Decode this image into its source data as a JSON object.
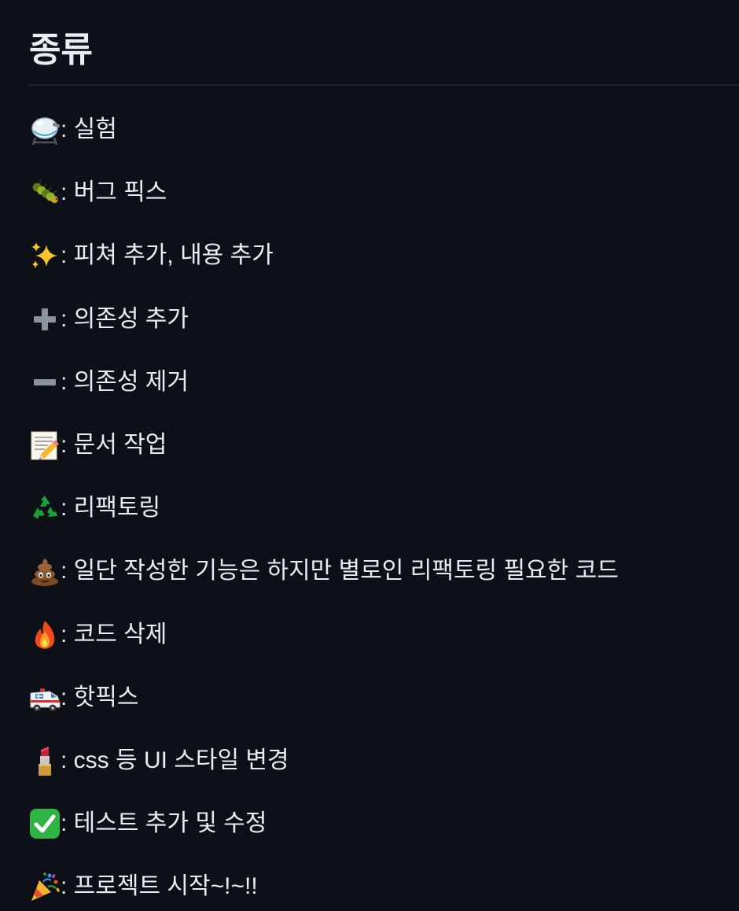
{
  "heading": "종류",
  "items": [
    {
      "icon": "alembic-icon",
      "label": ": 실험"
    },
    {
      "icon": "bug-icon",
      "label": ": 버그 픽스"
    },
    {
      "icon": "sparkles-icon",
      "label": ": 피쳐 추가, 내용 추가"
    },
    {
      "icon": "heavy-plus-icon",
      "label": " : 의존성 추가"
    },
    {
      "icon": "heavy-minus-icon",
      "label": " : 의존성 제거"
    },
    {
      "icon": "memo-icon",
      "label": ": 문서 작업"
    },
    {
      "icon": "recycle-icon",
      "label": ": 리팩토링"
    },
    {
      "icon": "poop-icon",
      "label": ": 일단 작성한 기능은 하지만 별로인 리팩토링 필요한 코드"
    },
    {
      "icon": "fire-icon",
      "label": ": 코드 삭제"
    },
    {
      "icon": "ambulance-icon",
      "label": ": 핫픽스"
    },
    {
      "icon": "lipstick-icon",
      "label": ": css 등 UI 스타일 변경"
    },
    {
      "icon": "check-mark-button-icon",
      "label": ": 테스트 추가 및 수정"
    },
    {
      "icon": "party-popper-icon",
      "label": ": 프로젝트 시작~!~!!"
    }
  ],
  "colors": {
    "background": "#0d1117",
    "text": "#e6edf3",
    "rule": "#21262d"
  }
}
